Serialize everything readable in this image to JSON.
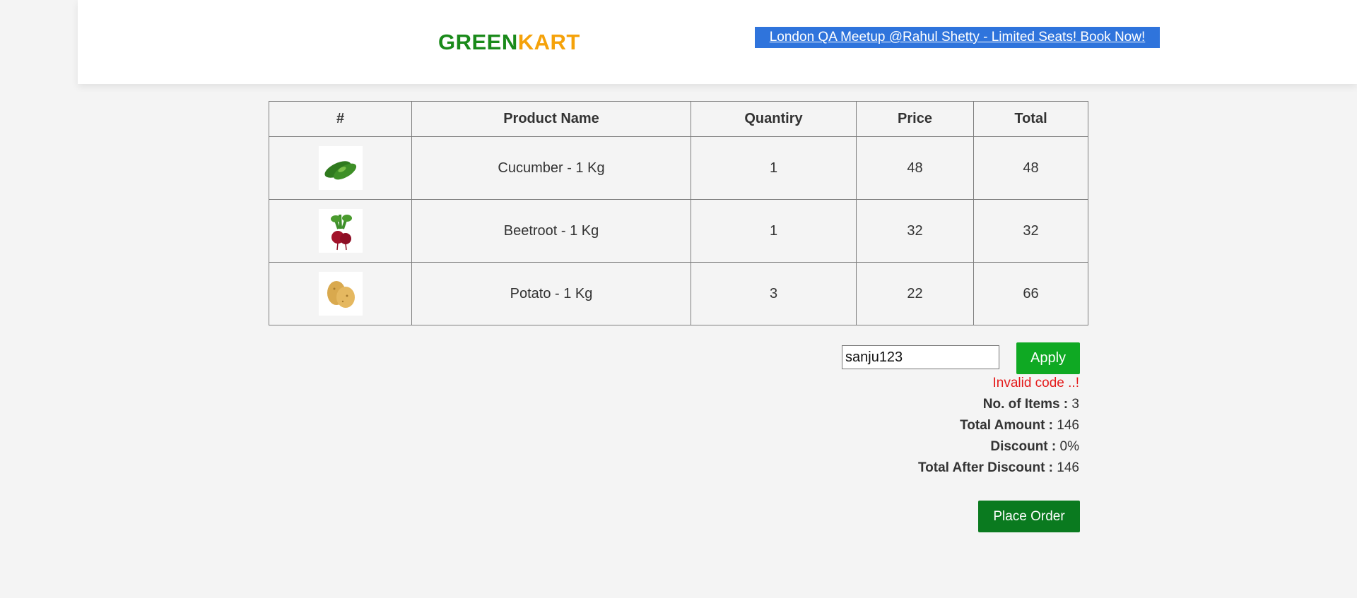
{
  "header": {
    "brand_part1": "GREEN",
    "brand_part2": "KART",
    "promo_link": "London QA Meetup @Rahul Shetty - Limited Seats! Book Now!"
  },
  "table": {
    "headers": [
      "#",
      "Product Name",
      "Quantiry",
      "Price",
      "Total"
    ],
    "rows": [
      {
        "image_icon": "cucumber-icon",
        "name": "Cucumber - 1 Kg",
        "quantity": "1",
        "price": "48",
        "total": "48"
      },
      {
        "image_icon": "beetroot-icon",
        "name": "Beetroot - 1 Kg",
        "quantity": "1",
        "price": "32",
        "total": "32"
      },
      {
        "image_icon": "potato-icon",
        "name": "Potato - 1 Kg",
        "quantity": "3",
        "price": "22",
        "total": "66"
      }
    ]
  },
  "promo": {
    "code_value": "sanju123",
    "apply_label": "Apply",
    "error_message": "Invalid code ..!"
  },
  "summary": {
    "items_label": "No. of Items :",
    "items_value": "3",
    "amount_label": "Total Amount :",
    "amount_value": "146",
    "discount_label": "Discount :",
    "discount_value": "0%",
    "after_label": "Total After Discount :",
    "after_value": "146"
  },
  "place_order_label": "Place Order",
  "colors": {
    "brand_green": "#1a8a1a",
    "brand_orange": "#f5a20a",
    "promo_blue": "#2f74dc",
    "apply_green": "#0fa923",
    "order_green": "#0a7a1f",
    "error_red": "#e41a1a"
  }
}
